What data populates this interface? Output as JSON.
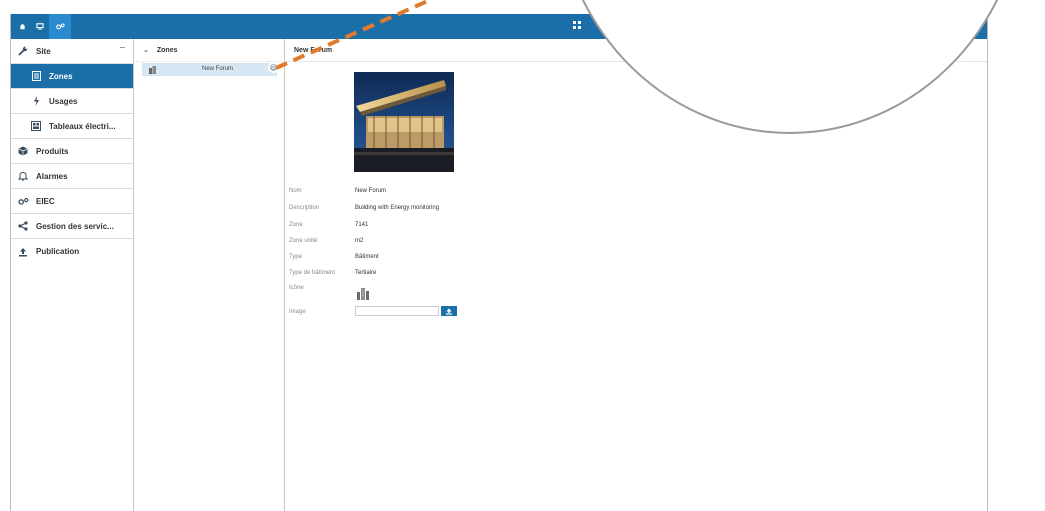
{
  "topbar": {
    "buttons": [
      {
        "icon": "home-icon"
      },
      {
        "icon": "monitor-icon"
      },
      {
        "icon": "gears-icon",
        "active": true
      }
    ]
  },
  "sidebar": {
    "items": [
      {
        "label": "Site",
        "icon": "wrench-icon"
      },
      {
        "label": "Zones",
        "icon": "list-icon",
        "active": true
      },
      {
        "label": "Usages",
        "icon": "lightning-icon"
      },
      {
        "label": "Tableaux électri...",
        "icon": "panel-icon"
      },
      {
        "label": "Produits",
        "icon": "cube-icon"
      },
      {
        "label": "Alarmes",
        "icon": "bell-icon"
      },
      {
        "label": "EIEC",
        "icon": "gears-icon"
      },
      {
        "label": "Gestion des servic...",
        "icon": "share-icon"
      },
      {
        "label": "Publication",
        "icon": "upload-icon"
      }
    ]
  },
  "tree": {
    "header": "Zones",
    "rows": [
      {
        "label": "New Forum",
        "icon": "building-icon"
      }
    ]
  },
  "detail": {
    "header": "New Forum",
    "fields": [
      {
        "label": "Nom",
        "value": "New Forum"
      },
      {
        "label": "Description",
        "value": "Building with Energy monitoring"
      },
      {
        "label": "Zone",
        "value": "7141"
      },
      {
        "label": "Zone unité",
        "value": "m2"
      },
      {
        "label": "Type",
        "value": "Bâtiment"
      },
      {
        "label": "Type de bâtiment",
        "value": "Tertiaire"
      },
      {
        "label": "Icône",
        "value": ""
      },
      {
        "label": "Image",
        "value": ""
      }
    ]
  },
  "colors": {
    "accent": "#1b6fa8",
    "callout_line": "#e07a2c",
    "selection": "#d6e6f2"
  }
}
